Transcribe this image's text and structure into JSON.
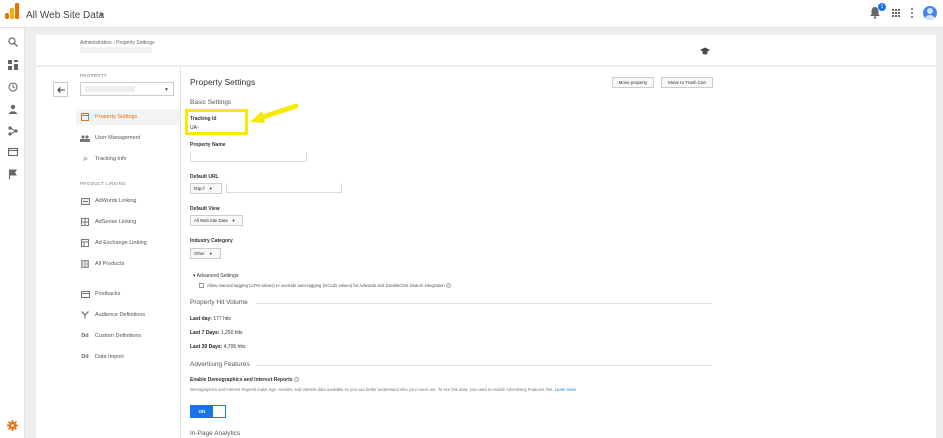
{
  "topbar": {
    "property_title": "All Web Site Data",
    "notification_count": "1"
  },
  "rail": {
    "icons": [
      "search-icon",
      "dashboard-icon",
      "clock-icon",
      "person-icon",
      "acquisition-icon",
      "behavior-icon",
      "flag-icon"
    ],
    "settings_icon": "gear-icon"
  },
  "breadcrumb": "Administration › Property Settings",
  "sidebar": {
    "property_label": "PROPERTY",
    "items": [
      {
        "label": "Property Settings",
        "icon": "settings-page-icon"
      },
      {
        "label": "User Management",
        "icon": "users-icon"
      },
      {
        "label": "Tracking Info",
        "icon": "js-icon"
      }
    ],
    "product_linking_label": "PRODUCT LINKING",
    "linking_items": [
      {
        "label": "AdWords Linking",
        "icon": "adwords-icon"
      },
      {
        "label": "AdSense Linking",
        "icon": "adsense-icon"
      },
      {
        "label": "Ad Exchange Linking",
        "icon": "adexchange-icon"
      },
      {
        "label": "All Products",
        "icon": "products-icon"
      }
    ],
    "other_items": [
      {
        "label": "Postbacks",
        "icon": "postbacks-icon"
      },
      {
        "label": "Audience Definitions",
        "icon": "audience-icon"
      },
      {
        "label": "Custom Definitions",
        "icon": "dd-icon"
      },
      {
        "label": "Data Import",
        "icon": "dd-icon"
      }
    ]
  },
  "main": {
    "title": "Property Settings",
    "move_property_label": "Move property",
    "move_trash_label": "Move to Trash Can",
    "basic_settings": "Basic Settings",
    "tracking_id_label": "Tracking Id",
    "tracking_id_value": "UA-",
    "property_name_label": "Property Name",
    "property_name_value": "",
    "default_url_label": "Default URL",
    "default_url_scheme": "http://",
    "default_url_value": "",
    "default_view_label": "Default View",
    "default_view_value": "All Web Site Data",
    "industry_label": "Industry Category",
    "industry_value": "Other",
    "advanced_label": "Advanced Settings",
    "advanced_checkbox_text": "Allow manual tagging (UTM values) to override auto-tagging (GCLID values) for Adwords and DoubleClick Search integration",
    "hit_volume_title": "Property Hit Volume",
    "last_day_label": "Last day:",
    "last_day_value": "177 hits",
    "last_7_label": "Last 7 Days:",
    "last_7_value": "1,250 hits",
    "last_30_label": "Last 30 Days:",
    "last_30_value": "4,706 hits",
    "advertising_title": "Advertising Features",
    "demographics_label": "Enable Demographics and Interest Reports",
    "demographics_desc": "Demographics and Interest Reports make Age, Gender, and Interest data available so you can better understand who your users are. To see this data, you need to enable Advertising Features first.",
    "learn_more": "Learn more",
    "toggle_label": "ON",
    "inpage_title": "In-Page Analytics"
  },
  "colors": {
    "accent": "#e8710a",
    "highlight": "#f6ea00",
    "brand_blue": "#1a73e8"
  }
}
